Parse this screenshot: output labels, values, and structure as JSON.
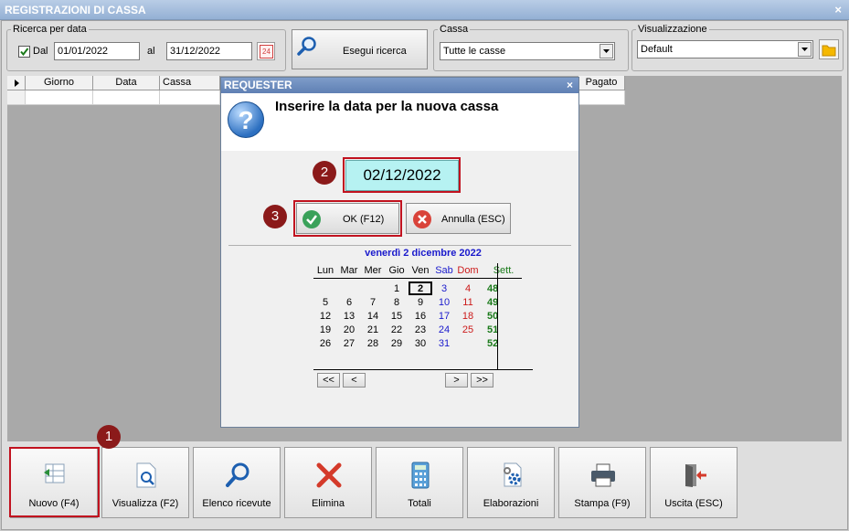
{
  "window": {
    "title": "REGISTRAZIONI DI CASSA",
    "close": "×"
  },
  "search": {
    "legend": "Ricerca per data",
    "dal_label": "Dal",
    "dal_checked": true,
    "from_date": "01/01/2022",
    "al_label": "al",
    "to_date": "31/12/2022",
    "calendar_icon_text": "24",
    "button_label": "Esegui ricerca"
  },
  "cassa": {
    "legend": "Cassa",
    "value": "Tutte le casse"
  },
  "visualizzazione": {
    "legend": "Visualizzazione",
    "value": "Default"
  },
  "grid": {
    "columns": [
      "Giorno",
      "Data",
      "Cassa",
      "Pagato"
    ]
  },
  "dialog": {
    "title": "REQUESTER",
    "close": "×",
    "question_icon": "?",
    "message": "Inserire la data per la nuova cassa",
    "date_value": "02/12/2022",
    "ok_label": "OK (F12)",
    "cancel_label": "Annulla (ESC)",
    "calendar": {
      "caption": "venerdì 2 dicembre 2022",
      "weekdays": [
        "Lun",
        "Mar",
        "Mer",
        "Gio",
        "Ven",
        "Sab",
        "Dom"
      ],
      "week_header": "Sett.",
      "weeks": [
        {
          "week": "48",
          "days": [
            "",
            "",
            "",
            "1",
            "2",
            "3",
            "4"
          ]
        },
        {
          "week": "49",
          "days": [
            "5",
            "6",
            "7",
            "8",
            "9",
            "10",
            "11"
          ]
        },
        {
          "week": "50",
          "days": [
            "12",
            "13",
            "14",
            "15",
            "16",
            "17",
            "18"
          ]
        },
        {
          "week": "51",
          "days": [
            "19",
            "20",
            "21",
            "22",
            "23",
            "24",
            "25"
          ]
        },
        {
          "week": "52",
          "days": [
            "26",
            "27",
            "28",
            "29",
            "30",
            "31",
            ""
          ]
        }
      ],
      "selected_day": "2",
      "nav": [
        "<<",
        "<",
        ">",
        ">>"
      ],
      "colors": {
        "caption": "#1a1acc",
        "saturday": "#1a1acc",
        "sunday": "#cc1a1a",
        "week": "#1a7a1a"
      }
    }
  },
  "markers": [
    "1",
    "2",
    "3"
  ],
  "bottom_buttons": [
    {
      "label": "Nuovo (F4)",
      "icon": "new-record-icon"
    },
    {
      "label": "Visualizza (F2)",
      "icon": "view-document-icon"
    },
    {
      "label": "Elenco ricevute",
      "icon": "search-icon"
    },
    {
      "label": "Elimina",
      "icon": "delete-icon"
    },
    {
      "label": "Totali",
      "icon": "calculator-icon"
    },
    {
      "label": "Elaborazioni",
      "icon": "settings-document-icon"
    },
    {
      "label": "Stampa (F9)",
      "icon": "printer-icon"
    },
    {
      "label": "Uscita (ESC)",
      "icon": "exit-icon"
    }
  ],
  "colors": {
    "highlight": "#c1121f",
    "marker": "#8b1a1a",
    "date_field": "#b6f2f2"
  }
}
